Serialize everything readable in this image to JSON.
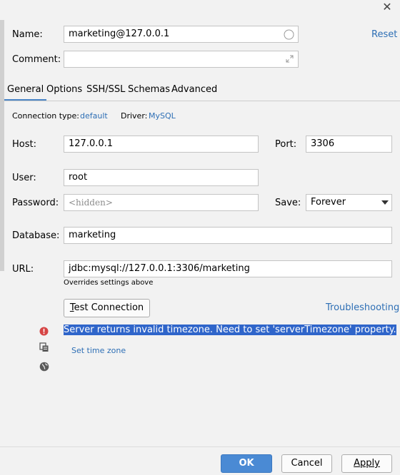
{
  "window": {
    "close_glyph": "✕"
  },
  "name": {
    "label": "Name:",
    "value": "marketing@127.0.0.1",
    "reset_label": "Reset"
  },
  "comment": {
    "label": "Comment:",
    "value": ""
  },
  "tabs": [
    {
      "label": "General",
      "active": true
    },
    {
      "label": "Options",
      "active": false
    },
    {
      "label": "SSH/SSL",
      "active": false
    },
    {
      "label": "Schemas",
      "active": false
    },
    {
      "label": "Advanced",
      "active": false
    }
  ],
  "connection": {
    "type_label": "Connection type:",
    "type_value": "default",
    "driver_label": "Driver:",
    "driver_value": "MySQL"
  },
  "host": {
    "label": "Host:",
    "value": "127.0.0.1"
  },
  "port": {
    "label": "Port:",
    "value": "3306"
  },
  "user": {
    "label": "User:",
    "value": "root"
  },
  "password": {
    "label": "Password:",
    "placeholder": "<hidden>"
  },
  "save": {
    "label": "Save:",
    "value": "Forever"
  },
  "database": {
    "label": "Database:",
    "value": "marketing"
  },
  "url": {
    "label": "URL:",
    "value": "jdbc:mysql://127.0.0.1:3306/marketing",
    "note": "Overrides settings above"
  },
  "actions": {
    "test_connection_prefix": "T",
    "test_connection_rest": "est Connection",
    "troubleshooting": "Troubleshooting"
  },
  "status": {
    "error_message": "Server returns invalid timezone. Need to set 'serverTimezone' property.",
    "fix_link": "Set time zone",
    "icons": [
      "error-icon",
      "copy-icon",
      "globe-icon"
    ],
    "error_color": "#d64545",
    "selection_color": "#2f65ca"
  },
  "footer": {
    "ok": "OK",
    "cancel": "Cancel",
    "apply": "Apply"
  },
  "colors": {
    "accent": "#4a8ad4",
    "link": "#2e6fb5",
    "background": "#f2f2f2"
  }
}
